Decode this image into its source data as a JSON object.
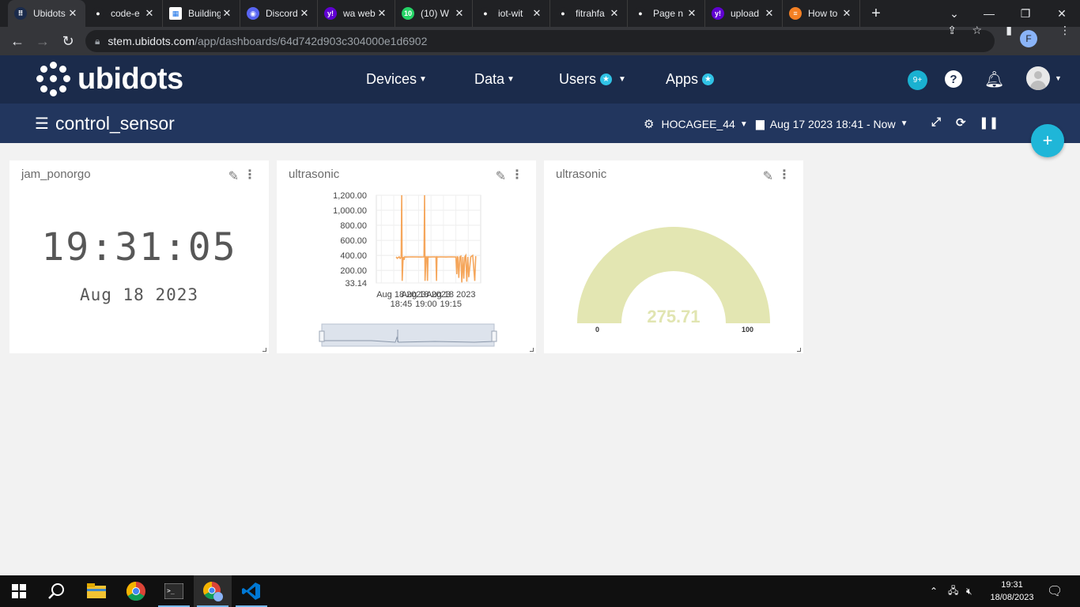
{
  "browser": {
    "tabs": [
      {
        "label": "Ubidots",
        "icon": "ubidots-icon",
        "color": "#1b2b4b",
        "glyph": "⠿"
      },
      {
        "label": "code-e",
        "icon": "github-icon",
        "color": "#202124",
        "glyph": "●"
      },
      {
        "label": "Building",
        "icon": "sheet-icon",
        "color": "#ffffff",
        "glyph": "▦"
      },
      {
        "label": "Discord",
        "icon": "discord-icon",
        "color": "#5865f2",
        "glyph": "◉"
      },
      {
        "label": "wa web",
        "icon": "yahoo-icon",
        "color": "#6001d2",
        "glyph": "y!"
      },
      {
        "label": "(10) W",
        "icon": "whatsapp-icon",
        "color": "#25d366",
        "glyph": "10"
      },
      {
        "label": "iot-wit",
        "icon": "github-icon",
        "color": "#202124",
        "glyph": "●"
      },
      {
        "label": "fitrahfa",
        "icon": "github-icon",
        "color": "#202124",
        "glyph": "●"
      },
      {
        "label": "Page n",
        "icon": "github-icon",
        "color": "#202124",
        "glyph": "●"
      },
      {
        "label": "upload",
        "icon": "yahoo-icon",
        "color": "#6001d2",
        "glyph": "y!"
      },
      {
        "label": "How to",
        "icon": "stackoverflow-icon",
        "color": "#f48024",
        "glyph": "≡"
      }
    ],
    "close_glyph": "✕",
    "new_tab_glyph": "+",
    "url_host": "stem.ubidots.com",
    "url_path": "/app/dashboards/64d742d903c304000e1d6902",
    "profile_letter": "F"
  },
  "header": {
    "logo_text": "ubidots",
    "nav": [
      {
        "label": "Devices",
        "star": false
      },
      {
        "label": "Data",
        "star": false
      },
      {
        "label": "Users",
        "star": true
      },
      {
        "label": "Apps",
        "star": true
      }
    ],
    "notifications": "9+",
    "help": "?"
  },
  "dashboard": {
    "title": "control_sensor",
    "device": "HOCAGEE_44",
    "range": "Aug 17 2023 18:41 - Now"
  },
  "widgets": {
    "clock": {
      "title": "jam_ponorgo",
      "time": "19:31:05",
      "date": "Aug 18 2023"
    },
    "chart": {
      "title": "ultrasonic"
    },
    "gauge": {
      "title": "ultrasonic",
      "value": "275.71",
      "min": "0",
      "max": "100"
    }
  },
  "chart_data": {
    "type": "line",
    "title": "",
    "xlabel": "",
    "ylabel": "",
    "y_ticks": [
      "1,200.00",
      "1,000.00",
      "800.00",
      "600.00",
      "400.00",
      "200.00",
      "33.14"
    ],
    "x_ticks": [
      {
        "line1": "Aug 18 2023",
        "line2": "18:45"
      },
      {
        "line1": "Aug 18 2023",
        "line2": "19:00"
      },
      {
        "line1": "Aug 18 2023",
        "line2": "19:15"
      }
    ],
    "ylim": [
      33.14,
      1200
    ],
    "x_minutes_range": [
      18.5,
      19.55
    ],
    "series": [
      {
        "color": "#f5a65b",
        "x": [
          18.7,
          18.71,
          18.73,
          18.74,
          18.75,
          18.755,
          18.76,
          18.77,
          18.78,
          18.785,
          18.79,
          18.8,
          18.86,
          18.95,
          18.98,
          18.985,
          18.99,
          19.0,
          19.01,
          19.015,
          19.02,
          19.03,
          19.1,
          19.105,
          19.11,
          19.12,
          19.15,
          19.2,
          19.25,
          19.3,
          19.31,
          19.315,
          19.32,
          19.33,
          19.34,
          19.35,
          19.36,
          19.37,
          19.38,
          19.39,
          19.4,
          19.41,
          19.42,
          19.43,
          19.45,
          19.47,
          19.49,
          19.5
        ],
        "y": [
          380,
          360,
          380,
          360,
          375,
          1200,
          60,
          380,
          340,
          380,
          380,
          378,
          380,
          378,
          380,
          1200,
          60,
          380,
          378,
          60,
          380,
          378,
          380,
          60,
          380,
          378,
          380,
          378,
          380,
          378,
          150,
          380,
          378,
          100,
          380,
          390,
          40,
          380,
          90,
          380,
          400,
          50,
          380,
          110,
          380,
          400,
          60,
          390
        ],
        "y_overrides_note": ""
      }
    ]
  },
  "taskbar": {
    "time": "19:31",
    "date": "18/08/2023"
  }
}
